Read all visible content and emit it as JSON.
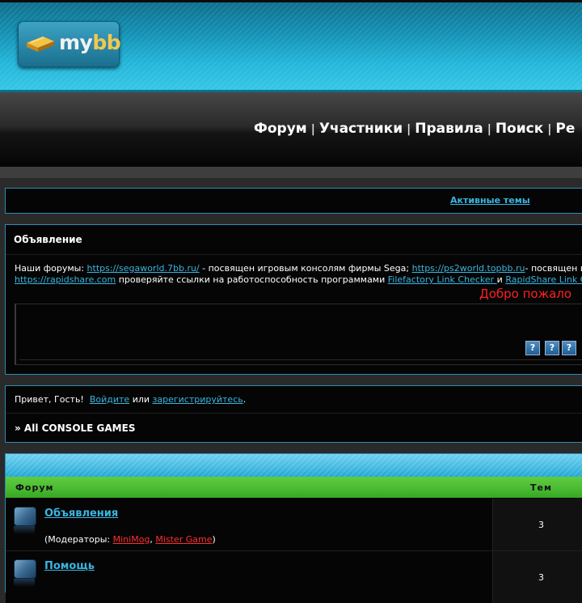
{
  "logo": {
    "text_main": "my",
    "text_accent": "bb"
  },
  "nav": {
    "items": [
      "Форум",
      "Участники",
      "Правила",
      "Поиск",
      "Ре"
    ],
    "separator": "|"
  },
  "active_topics": "Активные темы",
  "announcement": {
    "title": "Объявление",
    "line1_prefix": "Наши форумы: ",
    "link1": "https://segaworld.7bb.ru/",
    "line1_mid": " - посвящен игровым консолям фирмы Sega; ",
    "link2": "https://ps2world.topbb.ru",
    "line1_suffix": "- посвящен и",
    "link3": "https://rapidshare.com",
    "line2_mid": " проверяйте ссылки на работоспособность программами ",
    "link4": "Filefactory Link Checker ",
    "line2_and": " и ",
    "link5": "RapidShare Link C",
    "welcome": "Добро пожало",
    "buttons": [
      "?",
      "?",
      "?"
    ]
  },
  "greeting": {
    "prefix": "Привет, Гость!",
    "login": "Войдите",
    "or": " или ",
    "register": "зарегистрируйтесь",
    "suffix": "."
  },
  "breadcrumb": "» All CONSOLE GAMES",
  "forum_table": {
    "col_forum": "Форум",
    "col_topics": "Тем",
    "rows": [
      {
        "title": "Объявления",
        "mods_prefix": "(Модераторы: ",
        "mods": [
          "MiniMog",
          "Mister Game"
        ],
        "mods_sep": ", ",
        "mods_suffix": ")",
        "topics": "3"
      },
      {
        "title": "Помощь",
        "topics": "3"
      }
    ]
  }
}
